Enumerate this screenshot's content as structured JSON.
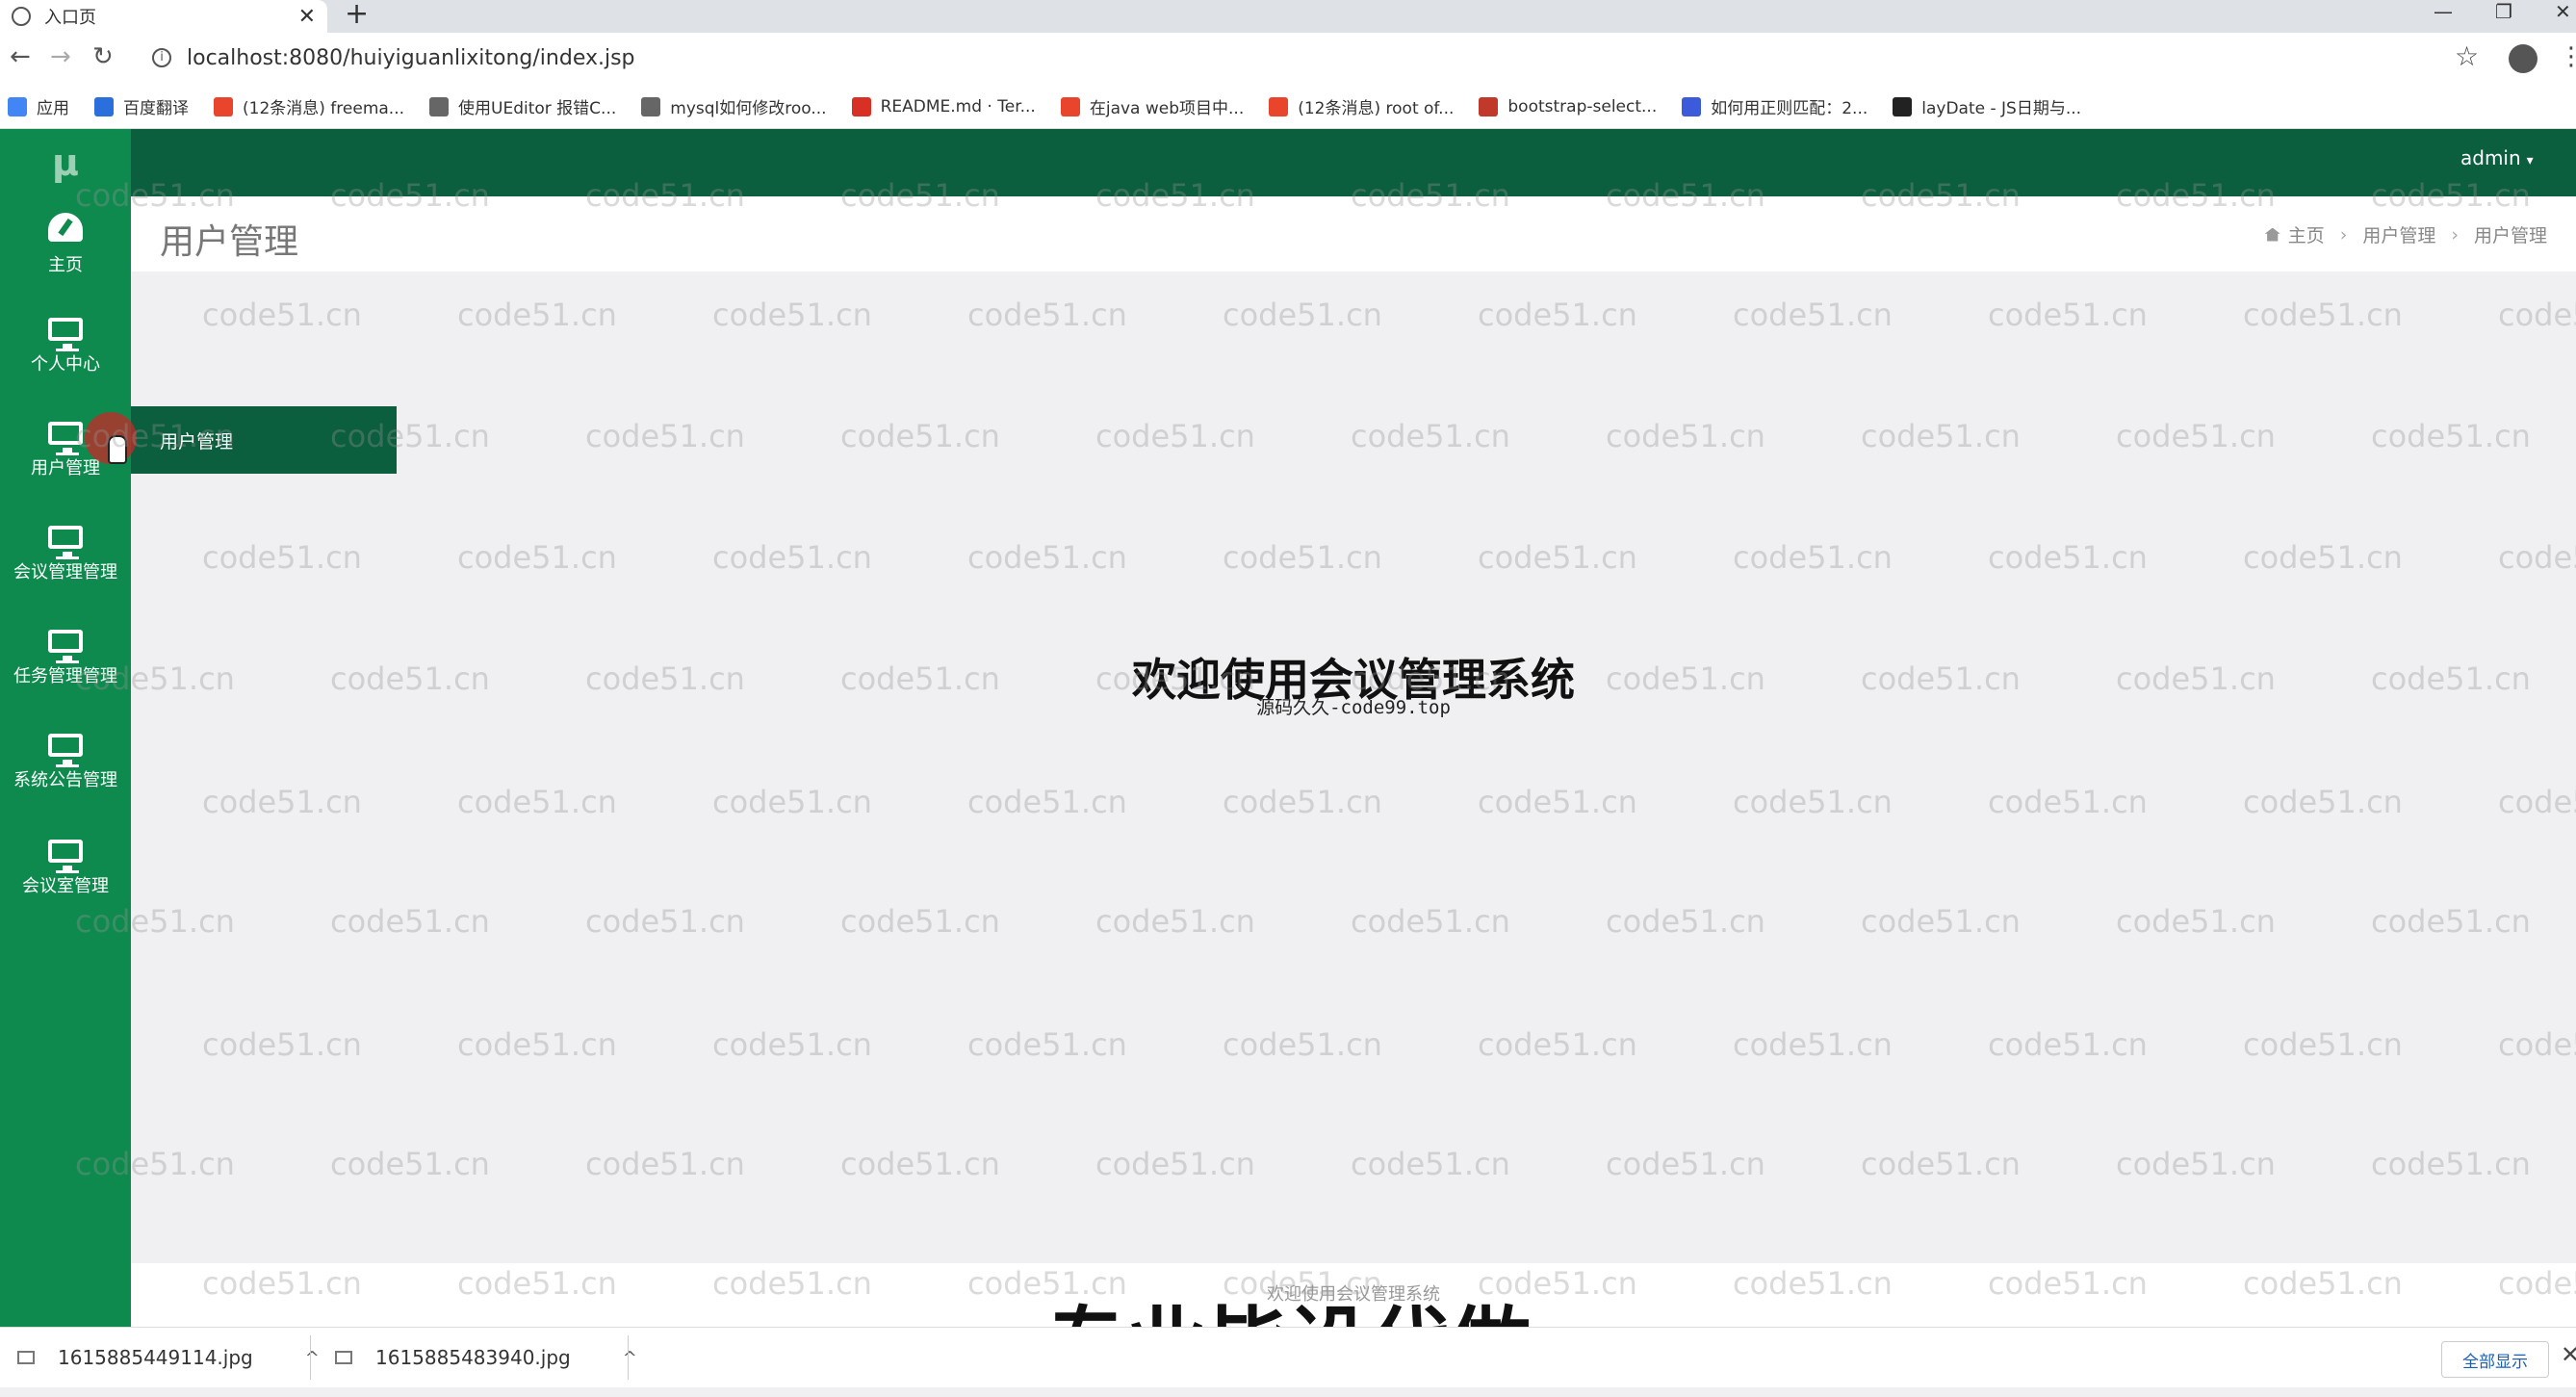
{
  "browser": {
    "tab_title": "入口页",
    "tab_close": "✕",
    "new_tab": "+",
    "url": "localhost:8080/huiyiguanlixitong/index.jsp",
    "window_controls": [
      "—",
      "❐",
      "✕"
    ],
    "bookmarks": [
      {
        "label": "应用",
        "color": "#4285f4"
      },
      {
        "label": "百度翻译",
        "color": "#2a6fdb"
      },
      {
        "label": "(12条消息) freema...",
        "color": "#e8452c"
      },
      {
        "label": "使用UEditor 报错C...",
        "color": "#666666"
      },
      {
        "label": "mysql如何修改roo...",
        "color": "#666666"
      },
      {
        "label": "README.md · Ter...",
        "color": "#d93025"
      },
      {
        "label": "在java web项目中...",
        "color": "#e8452c"
      },
      {
        "label": "(12条消息) root of...",
        "color": "#e8452c"
      },
      {
        "label": "bootstrap-select...",
        "color": "#c0392b"
      },
      {
        "label": "如何用正则匹配：2...",
        "color": "#3b5bdb"
      },
      {
        "label": "layDate - JS日期与...",
        "color": "#222222"
      }
    ]
  },
  "app": {
    "logo": "μ",
    "user_menu": "admin",
    "user_caret": "▾",
    "sidebar": [
      {
        "label": "主页"
      },
      {
        "label": "个人中心"
      },
      {
        "label": "用户管理"
      },
      {
        "label": "会议管理管理"
      },
      {
        "label": "任务管理管理"
      },
      {
        "label": "系统公告管理"
      },
      {
        "label": "会议室管理"
      }
    ],
    "flyout_item": "用户管理",
    "page_title": "用户管理",
    "breadcrumb": [
      "主页",
      "用户管理",
      "用户管理"
    ],
    "breadcrumb_sep": "›",
    "welcome_title": "欢迎使用会议管理系统",
    "welcome_sub": "源码久久-code99.top",
    "footer_text": "欢迎使用会议管理系统"
  },
  "overlay": {
    "watermark": "code51.cn",
    "banner": "专业毕设代做"
  },
  "downloads": {
    "files": [
      "1615885449114.jpg",
      "1615885483940.jpg"
    ],
    "chevron": "^",
    "show_all": "全部显示",
    "close": "✕"
  }
}
